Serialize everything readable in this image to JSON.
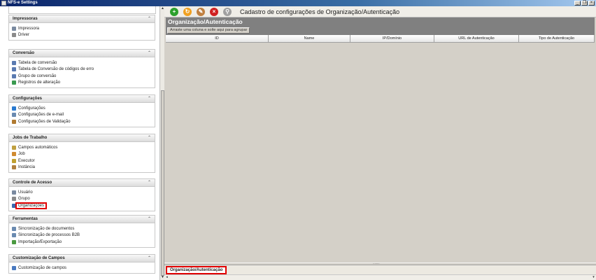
{
  "window": {
    "title": "NFS-e Settings",
    "buttons": {
      "minimize": "_",
      "restore": "❐",
      "close": "×"
    }
  },
  "sidebar": {
    "groups": [
      {
        "title": "Impressoras",
        "items": [
          {
            "label": "Impressora",
            "icon": "printer-icon",
            "color": "#7a8aa0"
          },
          {
            "label": "Driver",
            "icon": "driver-icon",
            "color": "#8a8a8a"
          }
        ]
      },
      {
        "title": "Conversão",
        "items": [
          {
            "label": "Tabela de conversão",
            "icon": "conversion-table-icon",
            "color": "#5a7ab0"
          },
          {
            "label": "Tabela de Conversão de códigos de erro",
            "icon": "error-code-table-icon",
            "color": "#5a7ab0"
          },
          {
            "label": "Grupo de conversão",
            "icon": "conversion-group-icon",
            "color": "#5a7ab0"
          },
          {
            "label": "Registros de alteração",
            "icon": "change-log-icon",
            "color": "#3a9a50"
          }
        ]
      },
      {
        "title": "Configurações",
        "items": [
          {
            "label": "Configurações",
            "icon": "globe-icon",
            "color": "#2a7ad0"
          },
          {
            "label": "Configurações de e-mail",
            "icon": "email-icon",
            "color": "#6a8ab0"
          },
          {
            "label": "Configurações de Validação",
            "icon": "validation-icon",
            "color": "#b07a30"
          }
        ]
      },
      {
        "title": "Jobs de Trabalho",
        "items": [
          {
            "label": "Campos automáticos",
            "icon": "auto-fields-icon",
            "color": "#c0a040"
          },
          {
            "label": "Job",
            "icon": "job-icon",
            "color": "#d08a30"
          },
          {
            "label": "Executor",
            "icon": "executor-icon",
            "color": "#c0a030"
          },
          {
            "label": "Instância",
            "icon": "instance-icon",
            "color": "#b08040"
          }
        ]
      },
      {
        "title": "Controle de Acesso",
        "items": [
          {
            "label": "Usuário",
            "icon": "user-icon",
            "color": "#7a8aa0"
          },
          {
            "label": "Grupo",
            "icon": "group-icon",
            "color": "#8a8a8a"
          },
          {
            "label": "Organizações",
            "icon": "organizations-icon",
            "color": "#3a6ab0",
            "selected": true
          }
        ]
      },
      {
        "title": "Ferramentas",
        "items": [
          {
            "label": "Sincronização de documentos",
            "icon": "sync-docs-icon",
            "color": "#6a8ab0"
          },
          {
            "label": "Sincronização de processos B2B",
            "icon": "sync-b2b-icon",
            "color": "#6a8ab0"
          },
          {
            "label": "Importação/Exportação",
            "icon": "import-export-icon",
            "color": "#4a9a40"
          }
        ]
      },
      {
        "title": "Customização de Campos",
        "items": [
          {
            "label": "Customização de campos",
            "icon": "field-custom-icon",
            "color": "#4a7ac0"
          }
        ]
      }
    ]
  },
  "toolbar": {
    "buttons": [
      {
        "name": "add",
        "icon": "add-icon",
        "glyph": "+",
        "color": "#2ca02c"
      },
      {
        "name": "refresh",
        "icon": "refresh-icon",
        "glyph": "↻",
        "color": "#f0a020"
      },
      {
        "name": "edit",
        "icon": "pencil-icon",
        "glyph": "✎",
        "color": "#c08040"
      },
      {
        "name": "delete",
        "icon": "delete-icon",
        "glyph": "×",
        "color": "#d02020"
      },
      {
        "name": "search",
        "icon": "search-icon",
        "glyph": "⚲",
        "color": "#a0a0a0"
      }
    ],
    "title": "Cadastro de configurações de Organização/Autenticação"
  },
  "panel": {
    "header": "Organização/Autenticação",
    "group_hint": "Arraste uma coluna e solte aqui para agrupar",
    "columns": [
      "ID",
      "Name",
      "IP/Domínio",
      "URL de Autenticação",
      "Tipo de Autenticação"
    ],
    "rows": []
  },
  "tabs": [
    {
      "label": "Organização/Autenticação",
      "active": true
    }
  ]
}
